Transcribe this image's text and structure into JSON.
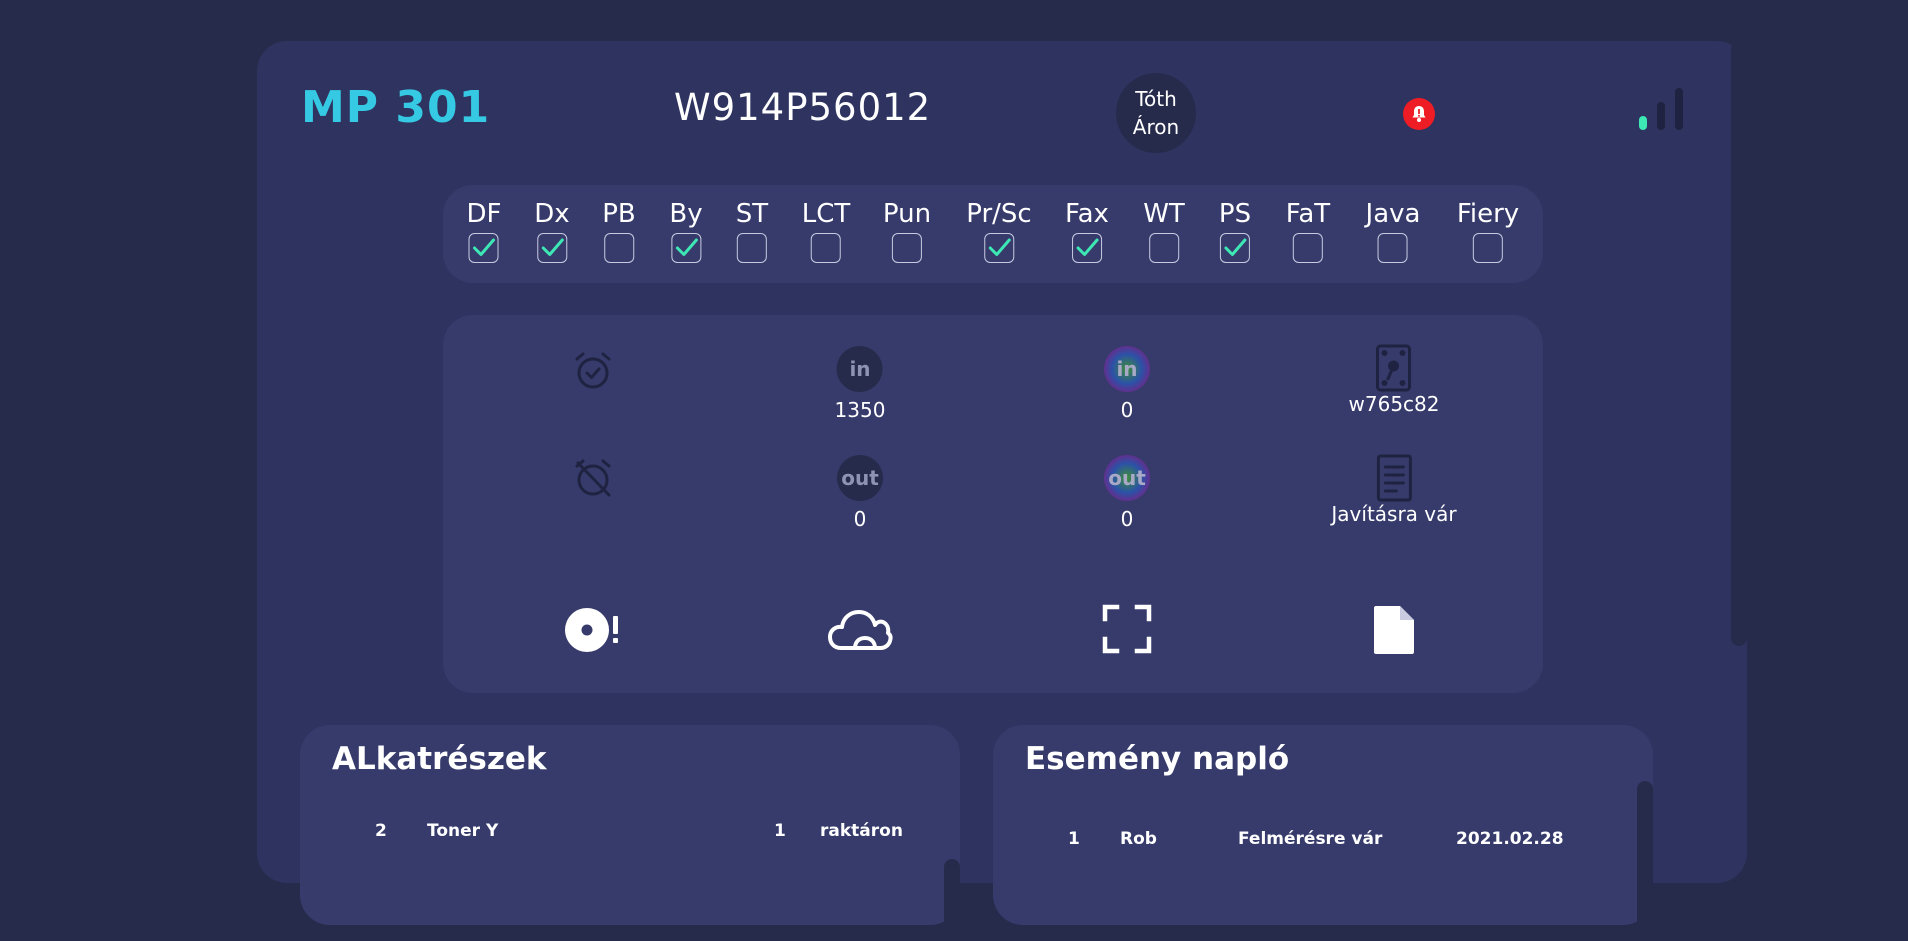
{
  "header": {
    "model": "MP 301",
    "serial": "W914P56012",
    "user_line1": "Tóth",
    "user_line2": "Áron",
    "alert_icon": "bell-alert-icon",
    "signal_icon": "signal-strength-icon",
    "signal_level": "1/3"
  },
  "options": [
    {
      "label": "DF",
      "checked": true
    },
    {
      "label": "Dx",
      "checked": true
    },
    {
      "label": "PB",
      "checked": false
    },
    {
      "label": "By",
      "checked": true
    },
    {
      "label": "ST",
      "checked": false
    },
    {
      "label": "LCT",
      "checked": false
    },
    {
      "label": "Pun",
      "checked": false
    },
    {
      "label": "Pr/Sc",
      "checked": true
    },
    {
      "label": "Fax",
      "checked": true
    },
    {
      "label": "WT",
      "checked": false
    },
    {
      "label": "PS",
      "checked": true
    },
    {
      "label": "FaT",
      "checked": false
    },
    {
      "label": "Java",
      "checked": false
    },
    {
      "label": "Fiery",
      "checked": false
    }
  ],
  "stats": {
    "bw_in_icon": "in",
    "bw_in_value": "1350",
    "color_in_icon": "in",
    "color_in_value": "0",
    "bw_out_icon": "out",
    "bw_out_value": "0",
    "color_out_icon": "out",
    "color_out_value": "0",
    "device_code": "w765c82",
    "status": "Javításra vár"
  },
  "parts": {
    "title": "ALkatrészek",
    "rows": [
      {
        "qty": "2",
        "name": "Toner Y",
        "count": "1",
        "state": "raktáron"
      }
    ]
  },
  "events": {
    "title": "Esemény napló",
    "rows": [
      {
        "id": "1",
        "user": "Rob",
        "state": "Felmérésre vár",
        "date": "2021.02.28"
      }
    ]
  },
  "colors": {
    "background": "#262b4b",
    "card": "#2e3360",
    "panel": "#363b6b",
    "accent": "#35c9e3",
    "check": "#3ee8b5",
    "alert": "#ee1c24"
  }
}
